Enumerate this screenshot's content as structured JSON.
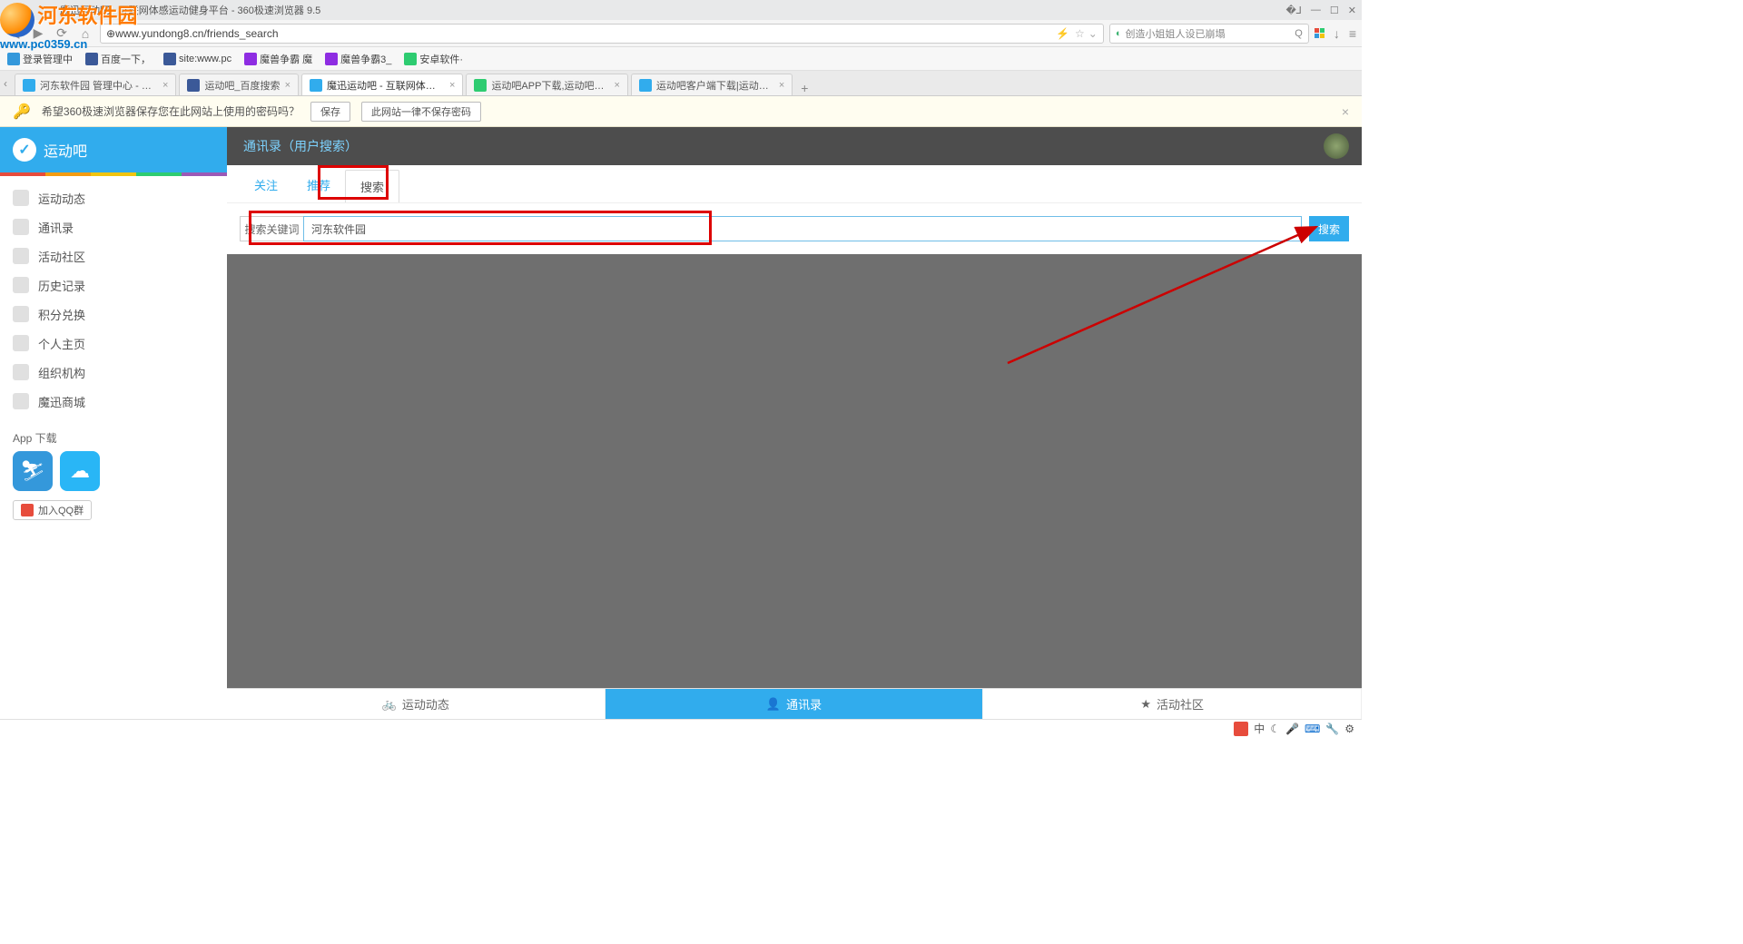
{
  "watermark": {
    "cn": "河东软件园",
    "url": "www.pc0359.cn"
  },
  "titlebar": {
    "title": "魔迅运动吧 - 互联网体感运动健身平台 - 360极速浏览器 9.5"
  },
  "address": {
    "proto": "☆ ",
    "url": "www.yundong8.cn/friends_search"
  },
  "searchbox": {
    "placeholder": "创造小姐姐人设已崩塌"
  },
  "bookmarks": [
    {
      "label": "登录管理中",
      "color": "#3498db"
    },
    {
      "label": "百度一下，",
      "color": "#3b5998"
    },
    {
      "label": "site:www.pc",
      "color": "#3b5998"
    },
    {
      "label": "魔兽争霸 魔",
      "color": "#8e2de2"
    },
    {
      "label": "魔兽争霸3_",
      "color": "#8e2de2"
    },
    {
      "label": "安卓软件·",
      "color": "#2ecc71"
    }
  ],
  "tabs": [
    {
      "label": "河东软件园 管理中心 - Powere",
      "color": "#31aced",
      "active": false
    },
    {
      "label": "运动吧_百度搜索",
      "color": "#3b5998",
      "active": false
    },
    {
      "label": "魔迅运动吧 - 互联网体感运动健",
      "color": "#31aced",
      "active": true
    },
    {
      "label": "运动吧APP下载,运动吧官方客户",
      "color": "#2ecc71",
      "active": false
    },
    {
      "label": "运动吧客户端下载|运动吧名师运",
      "color": "#31aced",
      "active": false
    }
  ],
  "pwbar": {
    "text": "希望360极速浏览器保存您在此网站上使用的密码吗？",
    "save": "保存",
    "never": "此网站一律不保存密码"
  },
  "sidebar": {
    "brand": "运动吧",
    "items": [
      "运动动态",
      "通讯录",
      "活动社区",
      "历史记录",
      "积分兑换",
      "个人主页",
      "组织机构",
      "魔迅商城"
    ],
    "appdl": "App 下载",
    "qq": "加入QQ群"
  },
  "main": {
    "header": "通讯录（用户搜索）",
    "subtabs": [
      "关注",
      "推荐",
      "搜索"
    ],
    "searchLabel": "搜索关键词",
    "searchValue": "河东软件园",
    "searchBtn": "搜索"
  },
  "bottomnav": [
    {
      "label": "运动动态",
      "active": false
    },
    {
      "label": "通讯录",
      "active": true
    },
    {
      "label": "活动社区",
      "active": false
    }
  ]
}
